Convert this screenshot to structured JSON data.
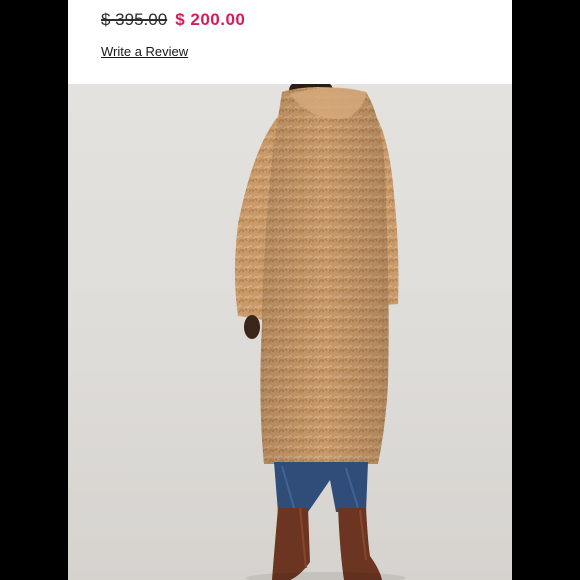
{
  "product": {
    "original_price": "$ 395.00",
    "sale_price": "$ 200.00",
    "review_link": "Write a Review"
  },
  "image": {
    "icon": "product-photo",
    "subject_colors": {
      "coat": "#c99a6a",
      "jeans": "#2f4d78",
      "boots": "#6b3522",
      "background": "#dedcd8"
    }
  },
  "colors": {
    "sale_price": "#d81b5c",
    "original_price": "#2d2d2d",
    "link": "#1a1a1a"
  }
}
